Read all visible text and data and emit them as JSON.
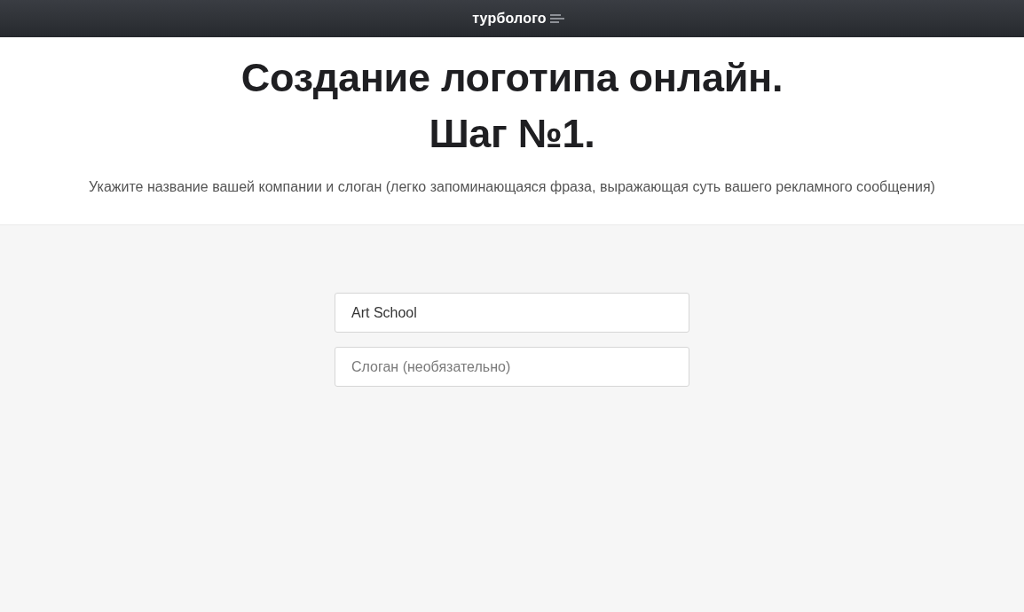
{
  "header": {
    "logo": "турболого"
  },
  "title_lines": [
    "Создание логотипа онлайн.",
    "Шаг №1."
  ],
  "subtitle": "Укажите название вашей компании и слоган (легко запоминающаяся фраза, выражающая суть вашего рекламного сообщения)",
  "fields": [
    {
      "value": "Art School"
    },
    {
      "placeholder": "Слоган (необязательно)"
    }
  ]
}
